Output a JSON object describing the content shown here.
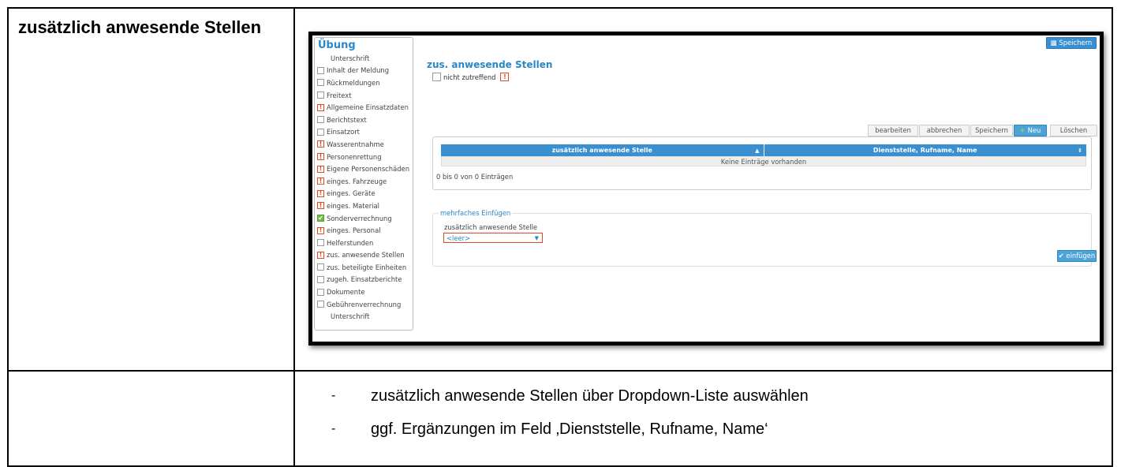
{
  "heading": "zusätzlich anwesende Stellen",
  "bullets": [
    "zusätzlich anwesende Stellen über Dropdown-Liste auswählen",
    "ggf. Ergänzungen im Feld ‚Dienststelle, Rufname, Name‘"
  ],
  "bullet_dash": "-",
  "screenshot": {
    "top_save_label": "Speichern",
    "sidebar": {
      "title": "Übung",
      "items": [
        {
          "label": "Unterschrift",
          "state": "none"
        },
        {
          "label": "Inhalt der Meldung",
          "state": "empty"
        },
        {
          "label": "Rückmeldungen",
          "state": "empty"
        },
        {
          "label": "Freitext",
          "state": "empty"
        },
        {
          "label": "Allgemeine Einsatzdaten",
          "state": "warn"
        },
        {
          "label": "Berichtstext",
          "state": "empty"
        },
        {
          "label": "Einsatzort",
          "state": "empty"
        },
        {
          "label": "Wasserentnahme",
          "state": "warn"
        },
        {
          "label": "Personenrettung",
          "state": "warn"
        },
        {
          "label": "Eigene Personenschäden",
          "state": "warn"
        },
        {
          "label": "einges. Fahrzeuge",
          "state": "warn"
        },
        {
          "label": "einges. Geräte",
          "state": "warn"
        },
        {
          "label": "einges. Material",
          "state": "warn"
        },
        {
          "label": "Sonderverrechnung",
          "state": "ok"
        },
        {
          "label": "einges. Personal",
          "state": "warn"
        },
        {
          "label": "Helferstunden",
          "state": "empty"
        },
        {
          "label": "zus. anwesende Stellen",
          "state": "warn"
        },
        {
          "label": "zus. beteiligte Einheiten",
          "state": "empty"
        },
        {
          "label": "zugeh. Einsatzberichte",
          "state": "empty"
        },
        {
          "label": "Dokumente",
          "state": "empty"
        },
        {
          "label": "Gebührenverrechnung",
          "state": "empty"
        },
        {
          "label": "Unterschrift",
          "state": "none"
        }
      ]
    },
    "section_title": "zus. anwesende Stellen",
    "not_applicable_label": "nicht zutreffend",
    "warn_glyph": "!",
    "toolbar": {
      "edit": "bearbeiten",
      "cancel": "abbrechen",
      "save": "Speichern",
      "new": "Neu",
      "delete": "Löschen"
    },
    "grid": {
      "columns": [
        "zusätzlich anwesende Stelle",
        "Dienststelle, Rufname, Name"
      ],
      "empty_text": "Keine Einträge vorhanden",
      "info": "0 bis 0 von 0 Einträgen"
    },
    "multi_insert": {
      "legend": "mehrfaches Einfügen",
      "field_label": "zusätzlich anwesende Stelle",
      "select_value": "<leer>",
      "insert_button": "einfügen"
    },
    "colors": {
      "accent_blue": "#3a8fd0",
      "warn_orange": "#e04b20",
      "ok_green": "#6fbf3a"
    }
  }
}
